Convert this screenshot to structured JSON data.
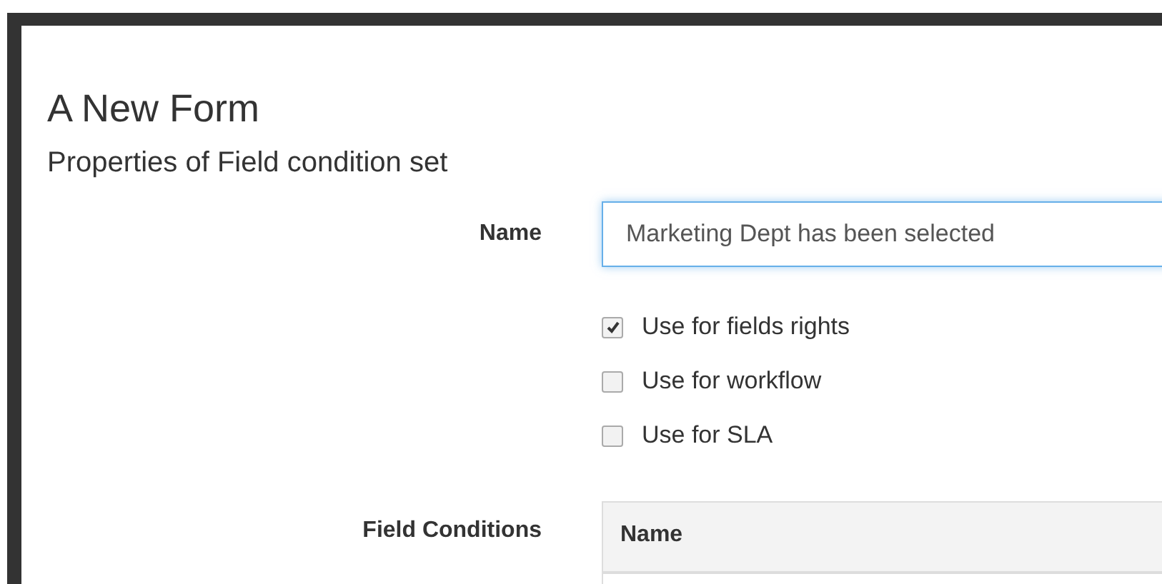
{
  "page": {
    "title": "A New Form",
    "subtitle": "Properties of Field condition set"
  },
  "name_field": {
    "label": "Name",
    "value": "Marketing Dept has been selected"
  },
  "options": [
    {
      "label": "Use for fields rights",
      "checked": true
    },
    {
      "label": "Use for workflow",
      "checked": false
    },
    {
      "label": "Use for SLA",
      "checked": false
    }
  ],
  "field_conditions": {
    "label": "Field Conditions",
    "columns": [
      "Name"
    ]
  }
}
